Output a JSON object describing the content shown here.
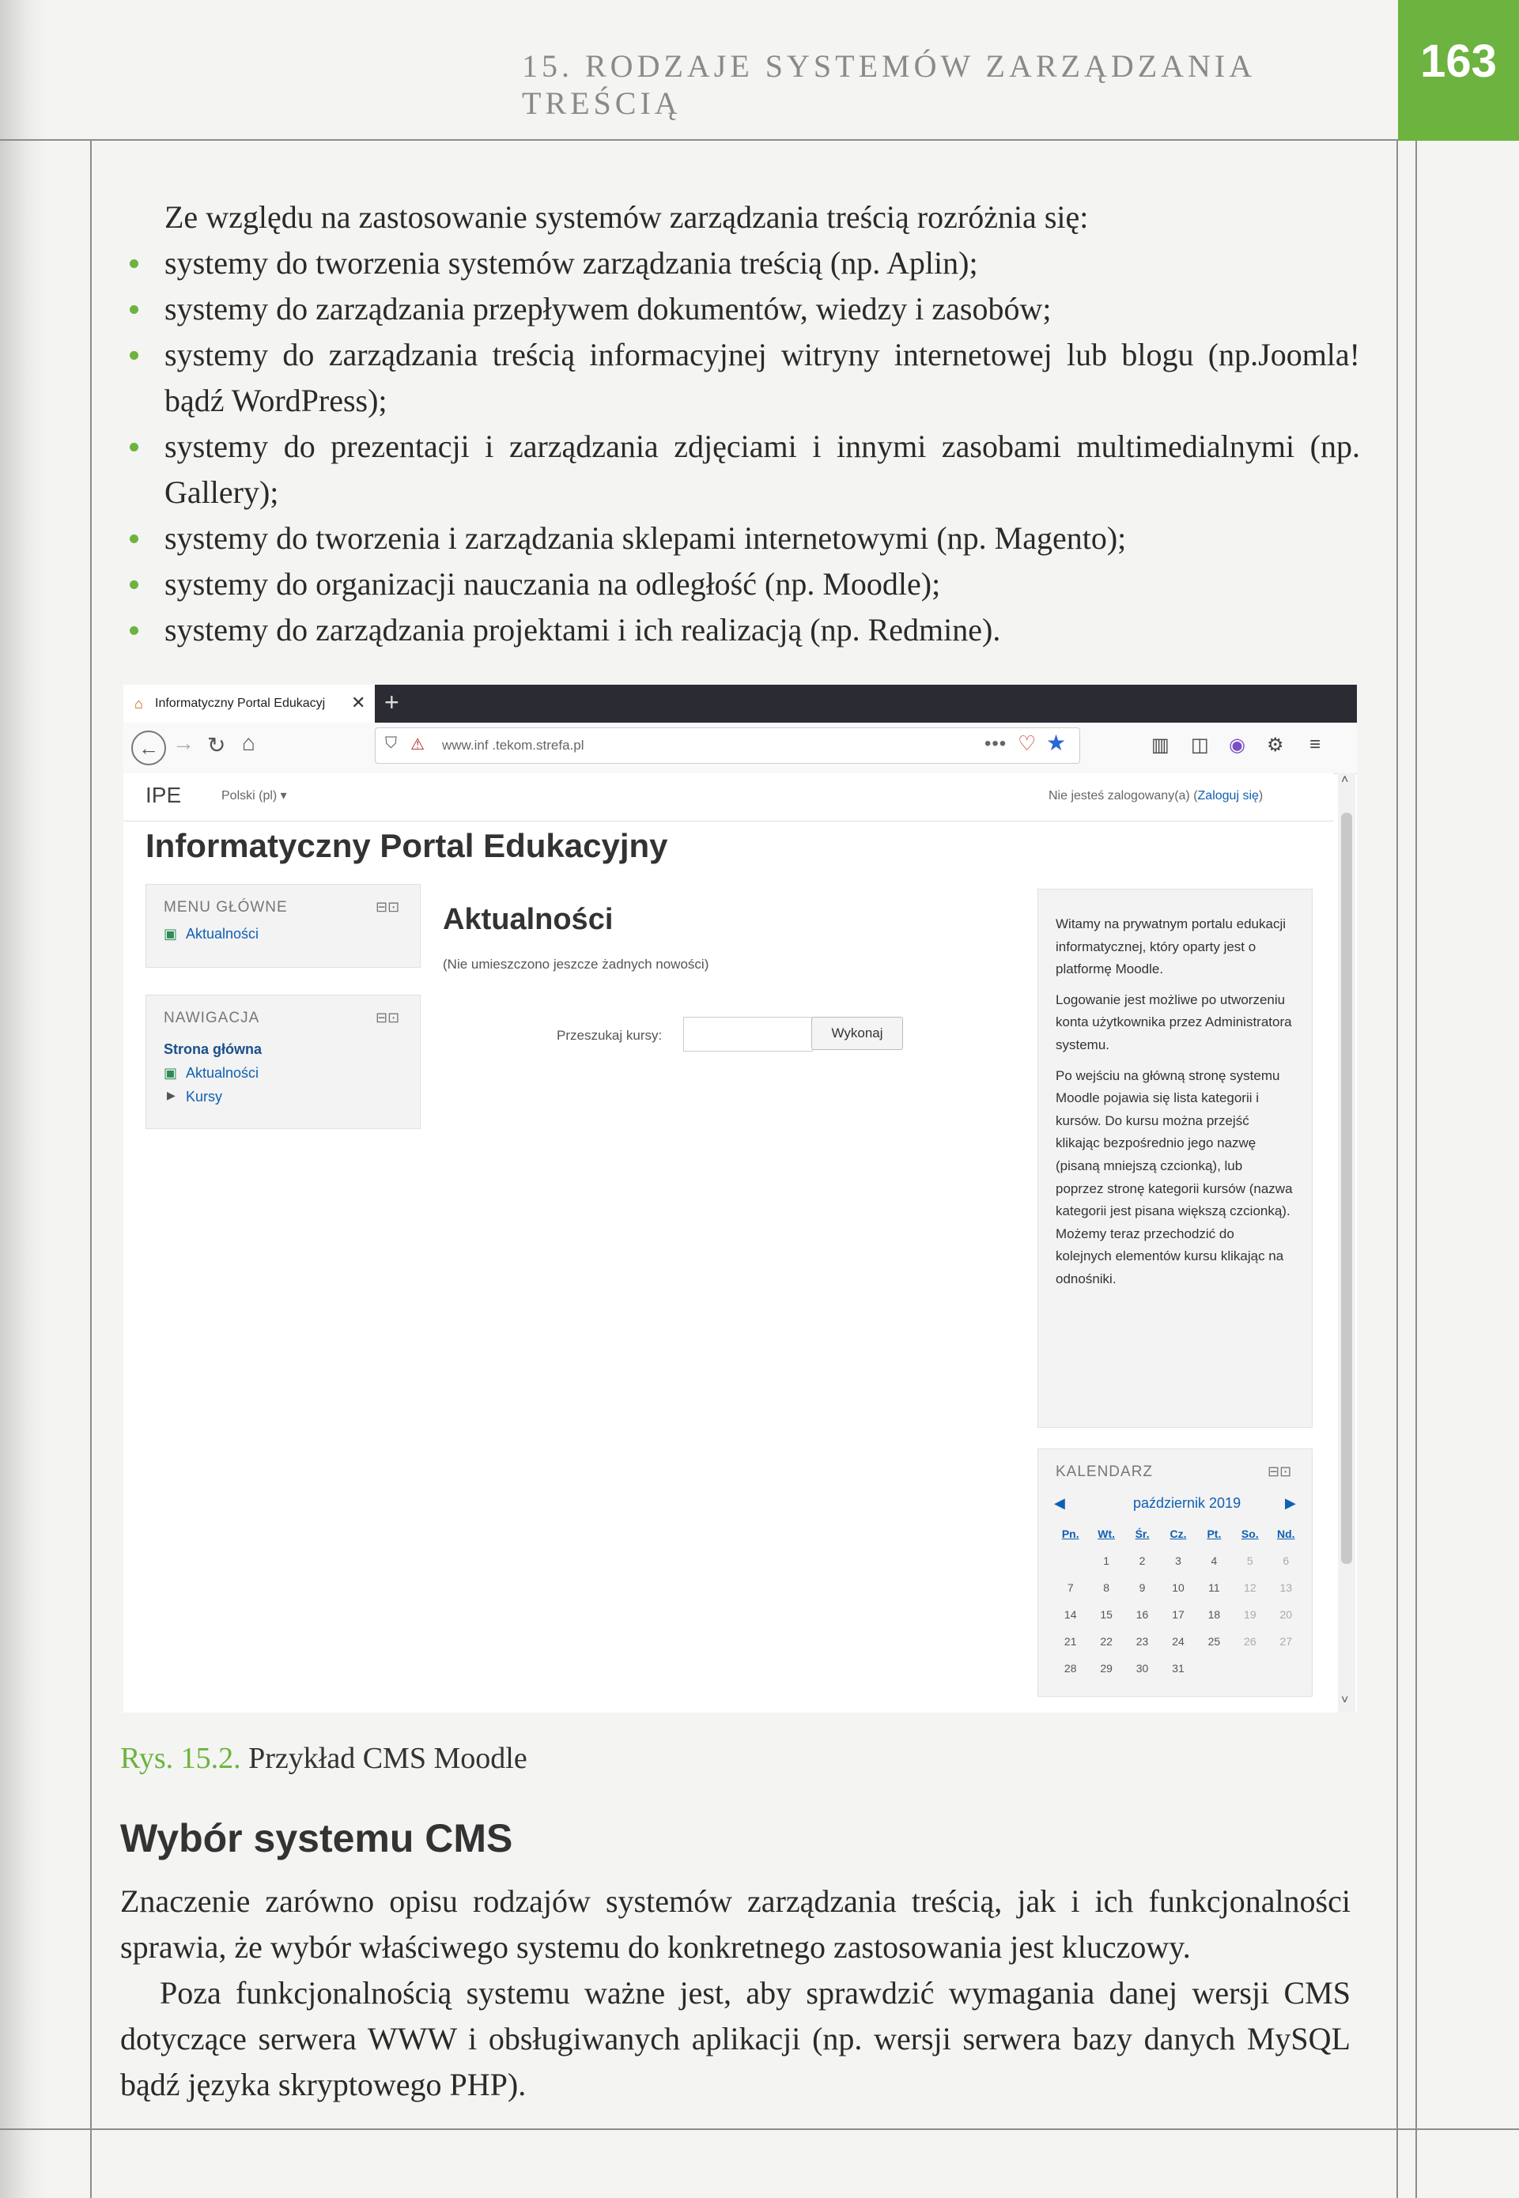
{
  "header": {
    "running_head": "15. RODZAJE SYSTEMÓW ZARZĄDZANIA TREŚCIĄ",
    "page_number": "163"
  },
  "intro": "Ze względu na zastosowanie systemów zarządzania treścią rozróżnia się:",
  "bullets": [
    "systemy do tworzenia systemów zarządzania treścią (np. Aplin);",
    "systemy do zarządzania przepływem dokumentów, wiedzy i zasobów;",
    "systemy do zarządzania treścią informacyjnej witryny internetowej lub blogu (np.Joomla! bądź WordPress);",
    "systemy do prezentacji i zarządzania zdjęciami i innymi zasobami multimedialnymi (np. Gallery);",
    "systemy do tworzenia i zarządzania sklepami internetowymi (np. Magento);",
    "systemy do organizacji nauczania na odległość (np. Moodle);",
    "systemy do zarządzania projektami i ich realizacją (np. Redmine)."
  ],
  "browser": {
    "tab_title": "Informatyczny Portal Edukacyj",
    "url": "www.inf    .tekom.strefa.pl",
    "new_tab": "+",
    "tab_close": "✕",
    "more_dots": "•••"
  },
  "moodle": {
    "brand": "IPE",
    "language": "Polski (pl) ▾",
    "login_prefix": "Nie jesteś zalogowany(a) (",
    "login_link": "Zaloguj się",
    "login_suffix": ")",
    "site_title": "Informatyczny Portal Edukacyjny",
    "main_menu": {
      "title": "MENU GŁÓWNE",
      "items": [
        "Aktualności"
      ]
    },
    "navigation": {
      "title": "NAWIGACJA",
      "home": "Strona główna",
      "items": [
        "Aktualności",
        "Kursy"
      ]
    },
    "main": {
      "heading": "Aktualności",
      "note": "(Nie umieszczono jeszcze żadnych nowości)",
      "search_label": "Przeszukaj kursy:",
      "search_value": "",
      "search_button": "Wykonaj"
    },
    "intro_paragraphs": [
      "Witamy na prywatnym portalu edukacji informatycznej, który oparty jest o platformę Moodle.",
      "Logowanie jest możliwe po utworzeniu konta użytkownika przez Administratora systemu.",
      "Po wejściu na główną stronę systemu Moodle pojawia się lista kategorii i kursów. Do kursu można przejść klikając bezpośrednio jego nazwę (pisaną mniejszą czcionką), lub poprzez stronę kategorii kursów (nazwa kategorii jest pisana większą czcionką). Możemy teraz przechodzić do kolejnych elementów kursu klikając na odnośniki."
    ],
    "calendar": {
      "title": "KALENDARZ",
      "month": "październik 2019",
      "days": [
        "Pn.",
        "Wt.",
        "Śr.",
        "Cz.",
        "Pt.",
        "So.",
        "Nd."
      ],
      "weeks": [
        [
          "",
          "1",
          "2",
          "3",
          "4",
          "5",
          "6"
        ],
        [
          "7",
          "8",
          "9",
          "10",
          "11",
          "12",
          "13"
        ],
        [
          "14",
          "15",
          "16",
          "17",
          "18",
          "19",
          "20"
        ],
        [
          "21",
          "22",
          "23",
          "24",
          "25",
          "26",
          "27"
        ],
        [
          "28",
          "29",
          "30",
          "31",
          "",
          "",
          ""
        ]
      ]
    }
  },
  "caption": {
    "number": "Rys. 15.2.",
    "text": " Przykład CMS Moodle"
  },
  "section": {
    "heading": "Wybór systemu CMS",
    "paragraphs": [
      "Znaczenie zarówno opisu rodzajów systemów zarządzania treścią, jak i ich funkcjonalności sprawia, że wybór właściwego systemu do konkretnego zastosowania jest kluczowy.",
      "Poza funkcjonalnością systemu ważne jest, aby sprawdzić wymagania danej wersji CMS dotyczące serwera WWW i obsługiwanych aplikacji (np. wersji serwera bazy danych MySQL bądź języka skryptowego PHP)."
    ]
  },
  "colors": {
    "accent_green": "#6db33f",
    "link_blue": "#0f5fb5"
  }
}
